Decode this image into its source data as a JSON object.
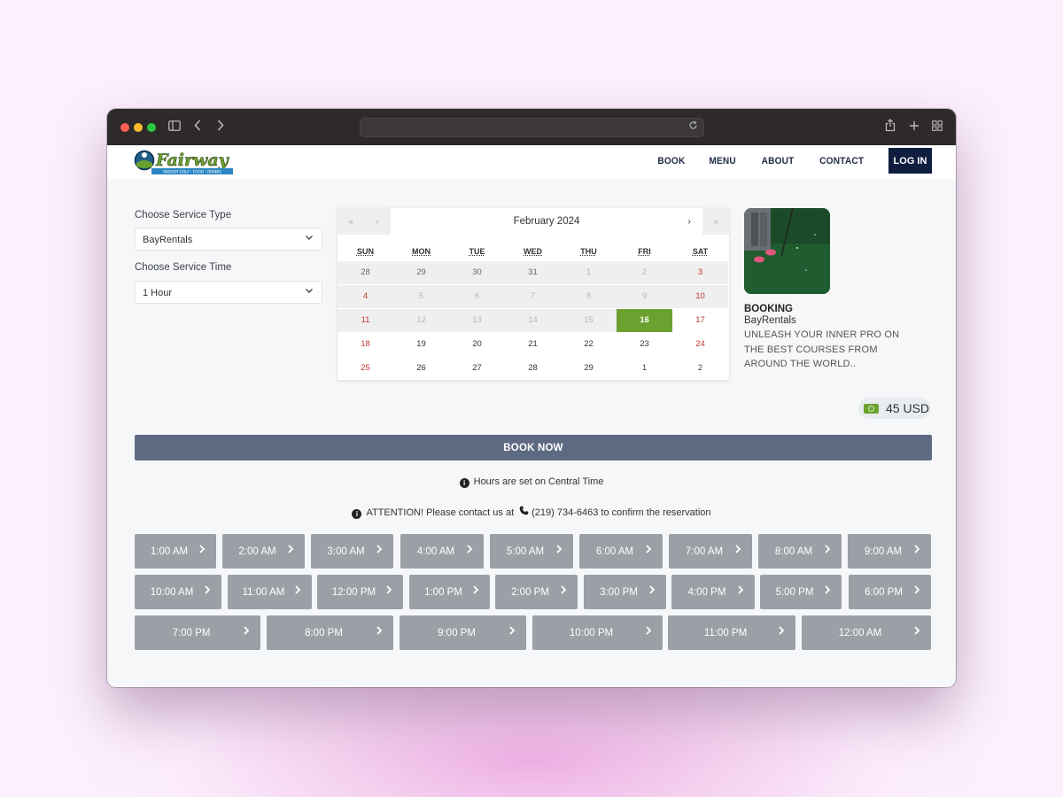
{
  "site": {
    "logo_text": "Fairway",
    "logo_tagline": "INDOOR GOLF · FOOD · DRINKS",
    "nav": [
      "BOOK",
      "MENU",
      "ABOUT",
      "CONTACT"
    ],
    "login_label": "LOG IN"
  },
  "form": {
    "service_type_label": "Choose Service Type",
    "service_type_value": "BayRentals",
    "service_time_label": "Choose Service Time",
    "service_time_value": "1 Hour"
  },
  "calendar": {
    "month_label": "February 2024",
    "nav": {
      "prev_year": "«",
      "prev_month": "‹",
      "next_month": "›",
      "next_year": "»"
    },
    "weekdays": [
      "SUN",
      "MON",
      "TUE",
      "WED",
      "THU",
      "FRI",
      "SAT"
    ],
    "weeks": [
      [
        "28",
        "29",
        "30",
        "31",
        "1",
        "2",
        "3"
      ],
      [
        "4",
        "5",
        "6",
        "7",
        "8",
        "9",
        "10"
      ],
      [
        "11",
        "12",
        "13",
        "14",
        "15",
        "16",
        "17"
      ],
      [
        "18",
        "19",
        "20",
        "21",
        "22",
        "23",
        "24"
      ],
      [
        "25",
        "26",
        "27",
        "28",
        "29",
        "1",
        "2"
      ]
    ],
    "selected_day": "16",
    "colors": {
      "selected": "#6ba12f",
      "weekend": "#c0392b",
      "disabled_bg": "#efefef",
      "disabled_text": "#b8b8b8"
    }
  },
  "booking": {
    "title": "BOOKING",
    "subtitle": "BayRentals",
    "description": "UNLEASH YOUR INNER PRO ON THE BEST COURSES FROM AROUND THE WORLD.."
  },
  "price": "45 USD",
  "book_now_label": "BOOK NOW",
  "notes": {
    "timezone": "Hours are set on Central Time",
    "attention_prefix": "ATTENTION! Please contact us at",
    "phone": "(219) 734-6463",
    "attention_suffix": "to confirm the reservation"
  },
  "time_slots": [
    [
      "1:00 AM",
      "2:00 AM",
      "3:00 AM",
      "4:00 AM",
      "5:00 AM",
      "6:00 AM",
      "7:00 AM",
      "8:00 AM",
      "9:00 AM"
    ],
    [
      "10:00 AM",
      "11:00 AM",
      "12:00 PM",
      "1:00 PM",
      "2:00 PM",
      "3:00 PM",
      "4:00 PM",
      "5:00 PM",
      "6:00 PM"
    ],
    [
      "7:00 PM",
      "8:00 PM",
      "9:00 PM",
      "10:00 PM",
      "11:00 PM",
      "12:00 AM"
    ]
  ],
  "icons": {
    "slot_arrow": "chevron-right-icon",
    "price": "money-icon",
    "info": "info-icon",
    "phone": "phone-icon"
  }
}
